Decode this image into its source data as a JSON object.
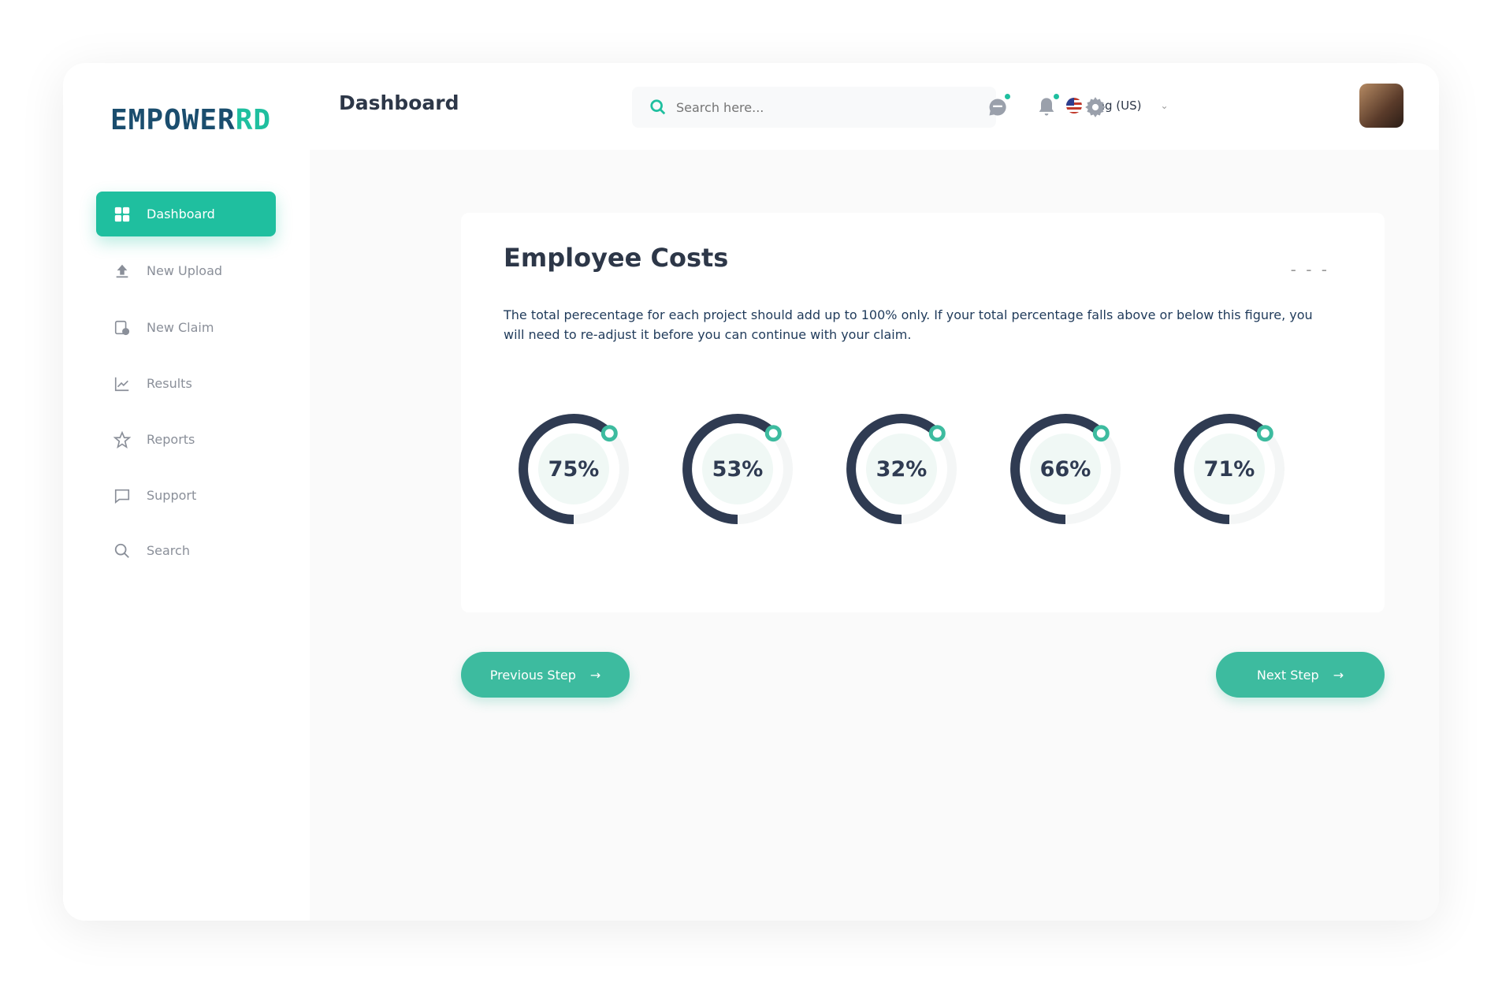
{
  "brand": {
    "logo_main": "EMPOWER",
    "logo_accent": "RD"
  },
  "header": {
    "title": "Dashboard",
    "search_placeholder": "Search here...",
    "language": "Eng (US)"
  },
  "sidebar": {
    "items": [
      {
        "label": "Dashboard",
        "icon": "grid-icon",
        "active": true
      },
      {
        "label": "New Upload",
        "icon": "upload-icon"
      },
      {
        "label": "New Claim",
        "icon": "new-claim-icon"
      },
      {
        "label": "Results",
        "icon": "chart-line-icon"
      },
      {
        "label": "Reports",
        "icon": "star-icon"
      },
      {
        "label": "Support",
        "icon": "chat-icon"
      },
      {
        "label": "Search",
        "icon": "search-icon"
      }
    ]
  },
  "panel": {
    "title": "Employee Costs",
    "more": "- - -",
    "description": "The total perecentage for each project should add up to 100% only. If your total percentage falls above or below this figure, you will need to re-adjust it before you can continue with your claim.",
    "donuts": [
      {
        "label": "75%",
        "value": 75
      },
      {
        "label": "53%",
        "value": 53
      },
      {
        "label": "32%",
        "value": 32
      },
      {
        "label": "66%",
        "value": 66
      },
      {
        "label": "71%",
        "value": 71
      }
    ]
  },
  "footer": {
    "previous": "Previous Step",
    "next": "Next Step"
  },
  "colors": {
    "accent": "#1fbf9f",
    "ring": "#2f3b52",
    "button": "#3dbb9f"
  }
}
